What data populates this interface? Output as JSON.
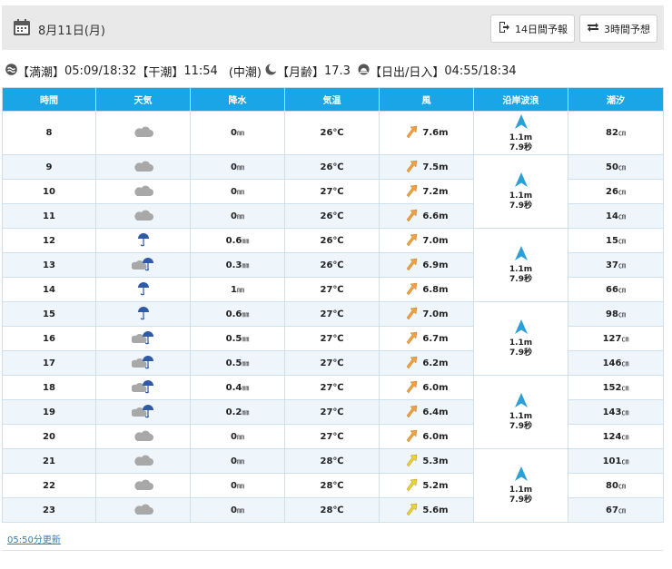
{
  "header": {
    "date": "8月11日(月)",
    "btn_14day": "14日間予報",
    "btn_3hour": "3時間予想"
  },
  "info": {
    "high_tide_label": "【満潮】",
    "high_tide_value": "05:09/18:32",
    "low_tide_label": "【干潮】",
    "low_tide_value": "11:54",
    "tide_type": "(中潮)",
    "moon_label": "【月齢】",
    "moon_value": "17.3",
    "sun_label": "【日出/日入】",
    "sun_value": "04:55/18:34"
  },
  "table": {
    "headers": [
      "時間",
      "天気",
      "降水",
      "気温",
      "風",
      "沿岸波浪",
      "潮汐"
    ],
    "rows": [
      {
        "hour": "8",
        "weather": "cloud",
        "precip": "0",
        "temp": "26℃",
        "wind": "7.6m",
        "wind_color": "orange",
        "tide": "82"
      },
      {
        "hour": "9",
        "weather": "cloud",
        "precip": "0",
        "temp": "26℃",
        "wind": "7.5m",
        "wind_color": "orange",
        "tide": "50"
      },
      {
        "hour": "10",
        "weather": "cloud",
        "precip": "0",
        "temp": "27℃",
        "wind": "7.2m",
        "wind_color": "orange",
        "tide": "26"
      },
      {
        "hour": "11",
        "weather": "cloud",
        "precip": "0",
        "temp": "26℃",
        "wind": "6.6m",
        "wind_color": "orange",
        "tide": "14"
      },
      {
        "hour": "12",
        "weather": "umbrella",
        "precip": "0.6",
        "temp": "26℃",
        "wind": "7.0m",
        "wind_color": "orange",
        "tide": "15"
      },
      {
        "hour": "13",
        "weather": "cloud-umbrella",
        "precip": "0.3",
        "temp": "26℃",
        "wind": "6.9m",
        "wind_color": "orange",
        "tide": "37"
      },
      {
        "hour": "14",
        "weather": "umbrella",
        "precip": "1",
        "temp": "27℃",
        "wind": "6.8m",
        "wind_color": "orange",
        "tide": "66"
      },
      {
        "hour": "15",
        "weather": "umbrella",
        "precip": "0.6",
        "temp": "27℃",
        "wind": "7.0m",
        "wind_color": "orange",
        "tide": "98"
      },
      {
        "hour": "16",
        "weather": "cloud-umbrella",
        "precip": "0.5",
        "temp": "27℃",
        "wind": "6.7m",
        "wind_color": "orange",
        "tide": "127"
      },
      {
        "hour": "17",
        "weather": "cloud-umbrella",
        "precip": "0.5",
        "temp": "27℃",
        "wind": "6.2m",
        "wind_color": "orange",
        "tide": "146"
      },
      {
        "hour": "18",
        "weather": "cloud-umbrella",
        "precip": "0.4",
        "temp": "27℃",
        "wind": "6.0m",
        "wind_color": "orange",
        "tide": "152"
      },
      {
        "hour": "19",
        "weather": "cloud-umbrella",
        "precip": "0.2",
        "temp": "27℃",
        "wind": "6.4m",
        "wind_color": "orange",
        "tide": "143"
      },
      {
        "hour": "20",
        "weather": "cloud",
        "precip": "0",
        "temp": "27℃",
        "wind": "6.0m",
        "wind_color": "orange",
        "tide": "124"
      },
      {
        "hour": "21",
        "weather": "cloud",
        "precip": "0",
        "temp": "28℃",
        "wind": "5.3m",
        "wind_color": "yellow",
        "tide": "101"
      },
      {
        "hour": "22",
        "weather": "cloud",
        "precip": "0",
        "temp": "28℃",
        "wind": "5.2m",
        "wind_color": "yellow",
        "tide": "80"
      },
      {
        "hour": "23",
        "weather": "cloud",
        "precip": "0",
        "temp": "28℃",
        "wind": "5.6m",
        "wind_color": "yellow",
        "tide": "67"
      }
    ],
    "waves": [
      {
        "height": "1.1m",
        "period": "7.9秒"
      },
      {
        "height": "1.1m",
        "period": "7.9秒"
      },
      {
        "height": "1.1m",
        "period": "7.9秒"
      },
      {
        "height": "1.1m",
        "period": "7.9秒"
      },
      {
        "height": "1.1m",
        "period": "7.9秒"
      },
      {
        "height": "1.1m",
        "period": "7.9秒"
      }
    ],
    "precip_unit": "㎜",
    "tide_unit": "㎝"
  },
  "footer": {
    "updated": "05:50分更新"
  },
  "colors": {
    "header_bg": "#1aa5e6",
    "wind_orange": "#f0a040",
    "wind_yellow": "#e6d62c",
    "rain_blue": "#2f5aa8",
    "wave_arrow": "#2a9fd8",
    "cloud_grey": "#a8a8a8"
  }
}
